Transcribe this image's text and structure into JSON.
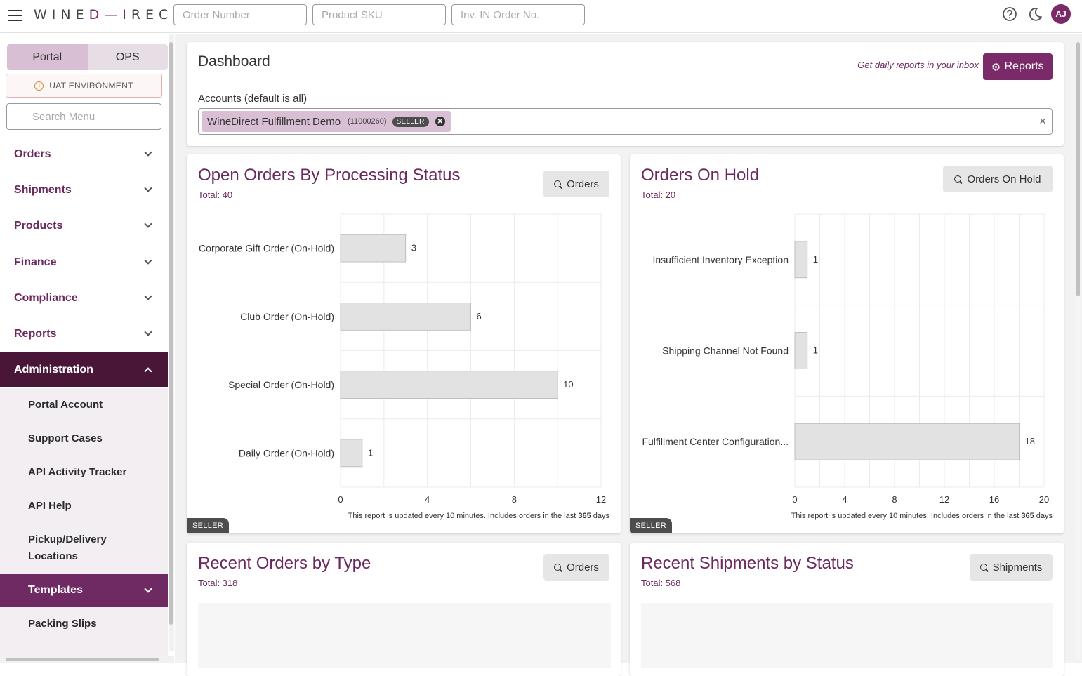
{
  "topbar": {
    "logo_left": "WINE",
    "logo_mark": "D—I",
    "logo_right": "RECT",
    "order_number_placeholder": "Order Number",
    "product_sku_placeholder": "Product SKU",
    "inv_placeholder": "Inv. IN Order No.",
    "avatar_initials": "AJ"
  },
  "sidebar": {
    "tab_portal": "Portal",
    "tab_ops": "OPS",
    "env_label": "UAT ENVIRONMENT",
    "search_placeholder": "Search Menu",
    "items": [
      "Orders",
      "Shipments",
      "Products",
      "Finance",
      "Compliance",
      "Reports"
    ],
    "admin_label": "Administration",
    "admin_items": [
      "Portal Account",
      "Support Cases",
      "API Activity Tracker",
      "API Help",
      "Pickup/Delivery Locations"
    ],
    "templates_label": "Templates",
    "templates_items": [
      "Packing Slips"
    ]
  },
  "dashboard": {
    "title": "Dashboard",
    "reports_note": "Get daily reports in your inbox",
    "reports_button": "Reports",
    "accounts_label": "Accounts (default is all)",
    "chip_name": "WineDirect Fulfillment Demo",
    "chip_id": "(11000260)",
    "chip_badge": "SELLER",
    "clear_icon": "×"
  },
  "cards": {
    "open_orders": {
      "title": "Open Orders By Processing Status",
      "total": "Total: 40",
      "button": "Orders",
      "note_prefix": "This report is updated every 10 minutes. Includes orders in the last ",
      "note_days": "365",
      "note_suffix": " days",
      "badge": "SELLER"
    },
    "on_hold": {
      "title": "Orders On Hold",
      "total": "Total: 20",
      "button": "Orders On Hold",
      "note_prefix": "This report is updated every 10 minutes. Includes orders in the last ",
      "note_days": "365",
      "note_suffix": " days",
      "badge": "SELLER"
    },
    "recent_orders": {
      "title": "Recent Orders by Type",
      "total": "Total: 318",
      "button": "Orders"
    },
    "recent_shipments": {
      "title": "Recent Shipments by Status",
      "total": "Total: 568",
      "button": "Shipments"
    }
  },
  "colors": {
    "brand": "#7a2a68",
    "admin_bg": "#4a1638",
    "bar_fill": "#e2e2e2",
    "bar_stroke": "#b5b5b5"
  },
  "chart_data": [
    {
      "type": "bar",
      "orientation": "horizontal",
      "categories": [
        "Corporate Gift Order (On-Hold)",
        "Club Order (On-Hold)",
        "Special Order (On-Hold)",
        "Daily Order (On-Hold)"
      ],
      "values": [
        3,
        6,
        10,
        1
      ],
      "xlim": [
        0,
        12
      ],
      "xticks": [
        0,
        4,
        8,
        12
      ],
      "grid": true
    },
    {
      "type": "bar",
      "orientation": "horizontal",
      "categories": [
        "Insufficient Inventory Exception",
        "Shipping Channel Not Found",
        "Fulfillment Center Configuration..."
      ],
      "values": [
        1,
        1,
        18
      ],
      "xlim": [
        0,
        20
      ],
      "xticks": [
        0,
        4,
        8,
        12,
        16,
        20
      ],
      "grid": true
    }
  ]
}
